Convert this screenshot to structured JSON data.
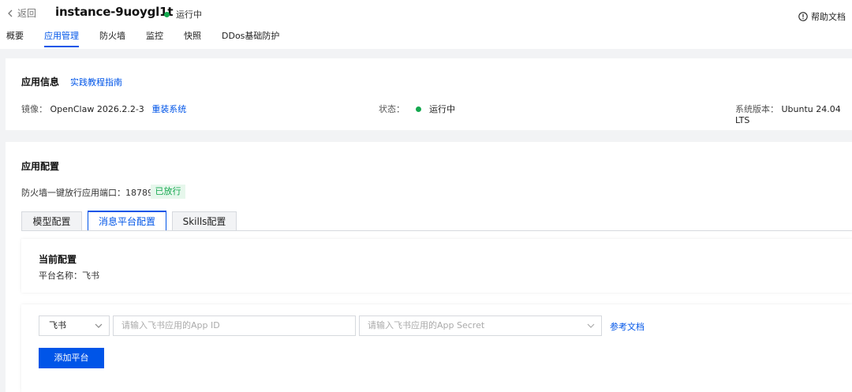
{
  "header": {
    "back_label": "返回",
    "instance_name": "instance-9uoygl1t",
    "status_text": "运行中",
    "status_color": "#14a84f",
    "help_label": "帮助文档"
  },
  "tabs": [
    {
      "label": "概要",
      "active": false
    },
    {
      "label": "应用管理",
      "active": true
    },
    {
      "label": "防火墙",
      "active": false
    },
    {
      "label": "监控",
      "active": false
    },
    {
      "label": "快照",
      "active": false
    },
    {
      "label": "DDos基础防护",
      "active": false
    }
  ],
  "app_info": {
    "title": "应用信息",
    "guide_link": "实践教程指南",
    "image_label": "镜像：",
    "image_value": "OpenClaw 2026.2.2-3",
    "reinstall_link": "重装系统",
    "status_label": "状态：",
    "status_value": "运行中",
    "os_label": "系统版本：",
    "os_value": "Ubuntu 24.04 LTS"
  },
  "app_config": {
    "title": "应用配置",
    "firewall_text": "防火墙一键放行应用端口：18789",
    "firewall_badge": "已放行",
    "cfg_tabs": [
      {
        "label": "模型配置",
        "active": false
      },
      {
        "label": "消息平台配置",
        "active": true
      },
      {
        "label": "Skills配置",
        "active": false
      }
    ],
    "current": {
      "title": "当前配置",
      "platform_line": "平台名称：飞书"
    },
    "form": {
      "platform_select": "飞书",
      "app_id_placeholder": "请输入飞书应用的App ID",
      "app_secret_placeholder": "请输入飞书应用的App Secret",
      "ref_link": "参考文档",
      "add_button": "添加平台"
    }
  },
  "colors": {
    "accent": "#0055e8",
    "success": "#14a84f",
    "background": "#f2f3f5"
  }
}
